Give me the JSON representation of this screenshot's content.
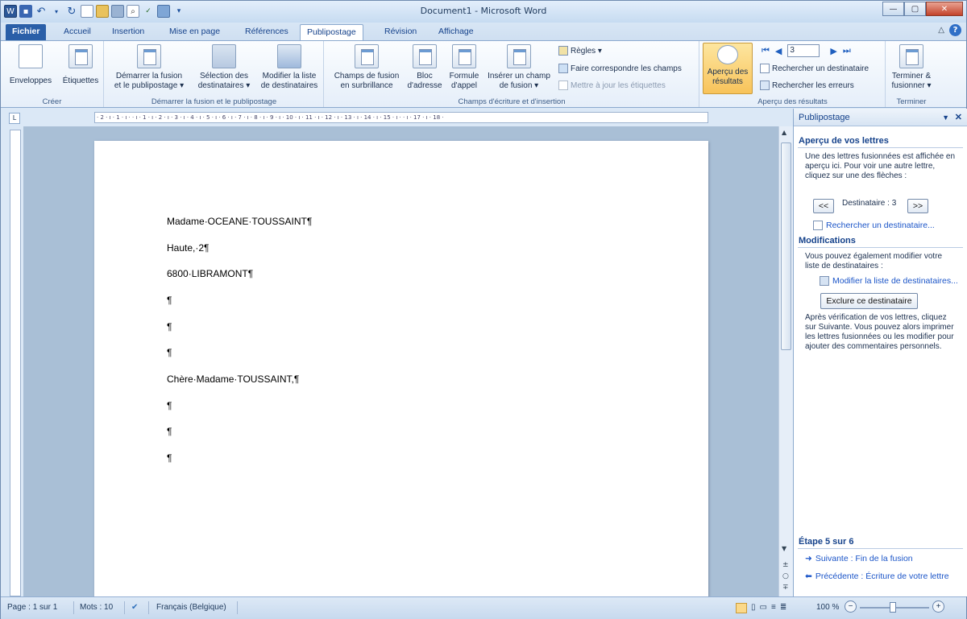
{
  "window": {
    "title": "Document1 - Microsoft Word"
  },
  "qat": {
    "icons": [
      "word-icon",
      "save-icon",
      "undo-icon",
      "redo-icon",
      "new-icon",
      "open-icon",
      "print-icon",
      "preview-icon",
      "spelling-icon",
      "chart-icon"
    ]
  },
  "tabs": [
    {
      "label": "Fichier"
    },
    {
      "label": "Accueil"
    },
    {
      "label": "Insertion"
    },
    {
      "label": "Mise en page"
    },
    {
      "label": "Références"
    },
    {
      "label": "Publipostage"
    },
    {
      "label": "Révision"
    },
    {
      "label": "Affichage"
    }
  ],
  "ribbon": {
    "groups": {
      "creer": {
        "label": "Créer",
        "enveloppes": "Enveloppes",
        "etiquettes": "Étiquettes"
      },
      "demarrer": {
        "label": "Démarrer la fusion et le publipostage",
        "start1": "Démarrer la fusion",
        "start2": "et le publipostage ▾",
        "sel1": "Sélection des",
        "sel2": "destinataires ▾",
        "mod1": "Modifier la liste",
        "mod2": "de destinataires"
      },
      "champs": {
        "label": "Champs d'écriture et d'insertion",
        "surl1": "Champs de fusion",
        "surl2": "en surbrillance",
        "bloc1": "Bloc",
        "bloc2": "d'adresse",
        "form1": "Formule",
        "form2": "d'appel",
        "ins1": "Insérer un champ",
        "ins2": "de fusion ▾",
        "regles": "Règles ▾",
        "correspondre": "Faire correspondre les champs",
        "majetiq": "Mettre à jour les étiquettes"
      },
      "apercu": {
        "label": "Aperçu des résultats",
        "btn1": "Aperçu des",
        "btn2": "résultats",
        "record": "3",
        "rechercher": "Rechercher un destinataire",
        "erreurs": "Rechercher les erreurs"
      },
      "terminer": {
        "label": "Terminer",
        "btn1": "Terminer &",
        "btn2": "fusionner ▾"
      }
    }
  },
  "ruler": {
    "marks": "· 2 · ı · 1 · ı ·  · ı · 1 · ı · 2 · ı · 3 · ı · 4 · ı · 5 · ı · 6 · ı · 7 · ı · 8 · ı · 9 · ı · 10 · ı · 11 · ı · 12 · ı · 13 · ı · 14 · ı · 15 · ı ·  · ı · 17 · ı · 18 ·"
  },
  "document": {
    "paragraphs": [
      "Madame·OCEANE·TOUSSAINT¶",
      "Haute,·2¶",
      "6800·LIBRAMONT¶",
      "¶",
      "¶",
      "¶",
      "Chère·Madame·TOUSSAINT,¶",
      "¶",
      "¶",
      "¶"
    ]
  },
  "pane": {
    "title": "Publipostage",
    "section1": "Aperçu de vos lettres",
    "intro": "Une des lettres fusionnées est affichée en aperçu ici. Pour voir une autre lettre, cliquez sur une des flèches :",
    "prev_btn": "<<",
    "next_btn": ">>",
    "recipient": "Destinataire : 3",
    "find_link": "Rechercher un destinataire...",
    "section2": "Modifications",
    "modif_text": "Vous pouvez également modifier votre liste de destinataires :",
    "edit_link": "Modifier la liste de destinataires...",
    "exclude_btn": "Exclure ce destinataire",
    "after_text": "Après vérification de vos lettres, cliquez sur Suivante. Vous pouvez alors imprimer les lettres fusionnées ou les modifier pour ajouter des commentaires personnels.",
    "step": "Étape 5 sur 6",
    "next_link": "Suivante : Fin de la fusion",
    "prev_link": "Précédente : Écriture de votre lettre"
  },
  "status": {
    "page": "Page : 1 sur 1",
    "words": "Mots : 10",
    "language": "Français (Belgique)",
    "zoom": "100 %"
  }
}
